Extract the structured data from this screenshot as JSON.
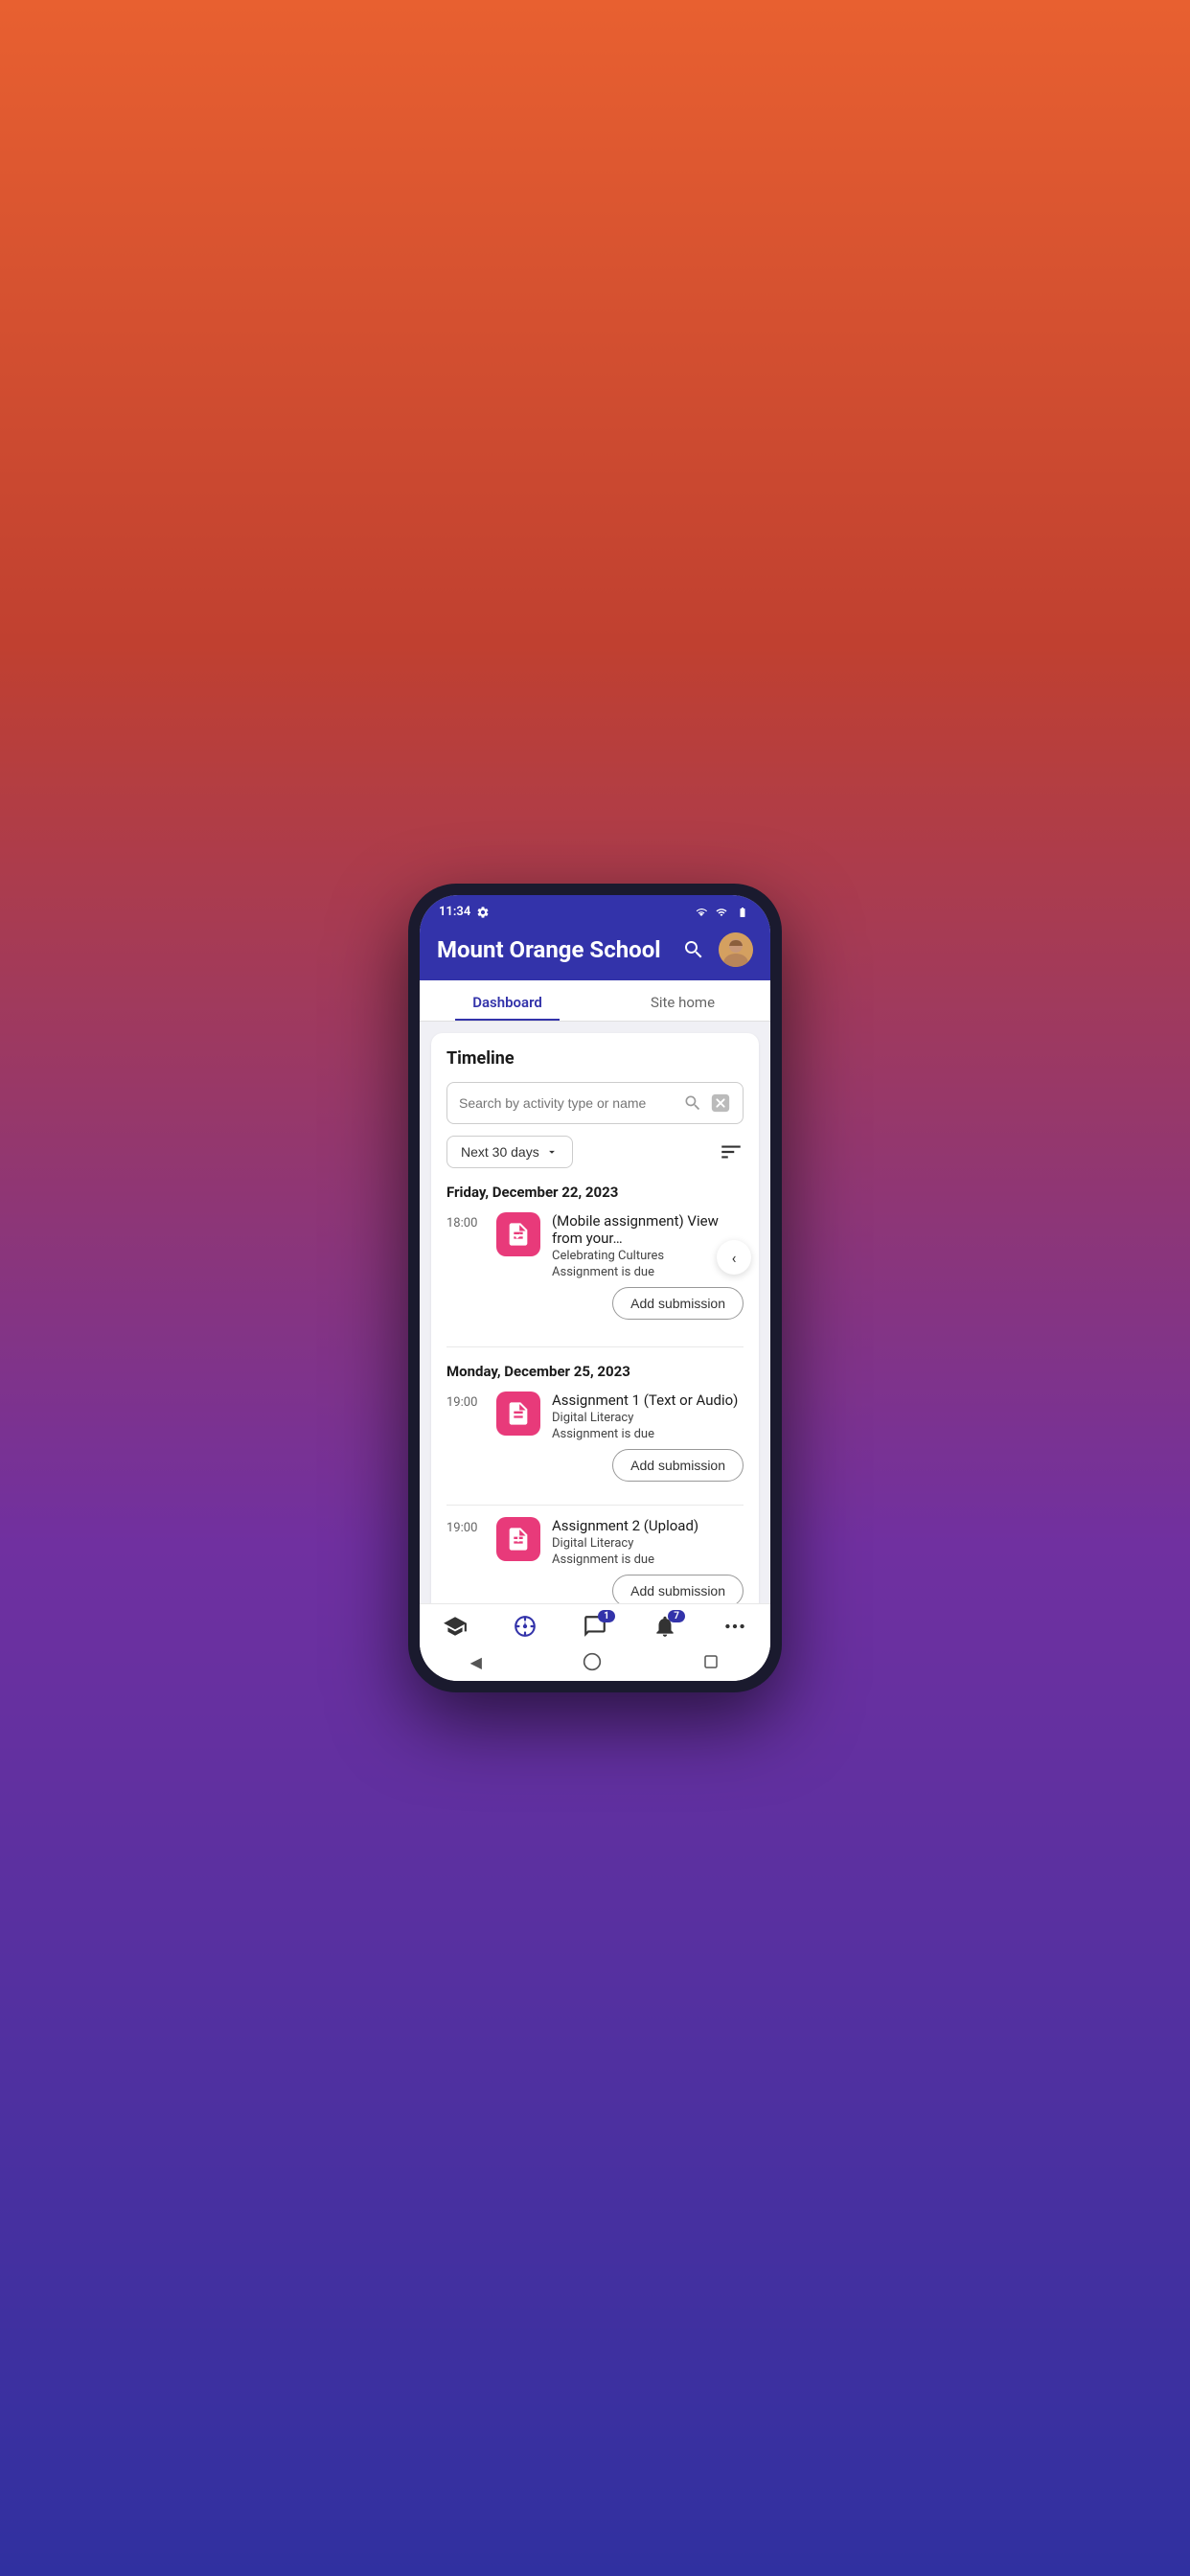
{
  "statusBar": {
    "time": "11:34",
    "icons": [
      "settings",
      "wifi",
      "signal",
      "battery"
    ]
  },
  "header": {
    "title": "Mount Orange School",
    "searchIconLabel": "search-icon",
    "avatarLabel": "user-avatar"
  },
  "tabs": [
    {
      "label": "Dashboard",
      "active": true
    },
    {
      "label": "Site home",
      "active": false
    }
  ],
  "timeline": {
    "sectionTitle": "Timeline",
    "search": {
      "placeholder": "Search by activity type or name"
    },
    "filter": {
      "dropdownLabel": "Next 30 days",
      "sortIconLabel": "sort-icon"
    },
    "sections": [
      {
        "date": "Friday, December 22, 2023",
        "items": [
          {
            "time": "18:00",
            "name": "(Mobile assignment) View from your…",
            "course": "Celebrating Cultures",
            "status": "Assignment is due",
            "actionLabel": "Add submission"
          }
        ]
      },
      {
        "date": "Monday, December 25, 2023",
        "items": [
          {
            "time": "19:00",
            "name": "Assignment 1 (Text or Audio)",
            "course": "Digital Literacy",
            "status": "Assignment is due",
            "actionLabel": "Add submission"
          },
          {
            "time": "19:00",
            "name": "Assignment 2 (Upload)",
            "course": "Digital Literacy",
            "status": "Assignment is due",
            "actionLabel": "Add submission"
          }
        ]
      }
    ]
  },
  "bottomNav": [
    {
      "icon": "graduation-cap",
      "label": "Home",
      "badge": null
    },
    {
      "icon": "dashboard",
      "label": "Dashboard",
      "badge": null
    },
    {
      "icon": "messages",
      "label": "Messages",
      "badge": "1"
    },
    {
      "icon": "bell",
      "label": "Notifications",
      "badge": "7"
    },
    {
      "icon": "more",
      "label": "More",
      "badge": null
    }
  ],
  "androidNav": [
    {
      "icon": "back",
      "label": "back-button"
    },
    {
      "icon": "home",
      "label": "home-button"
    },
    {
      "icon": "square",
      "label": "recent-button"
    }
  ],
  "colors": {
    "primary": "#3333aa",
    "accent": "#e83a7a",
    "background": "#f0f0f5",
    "white": "#ffffff"
  }
}
